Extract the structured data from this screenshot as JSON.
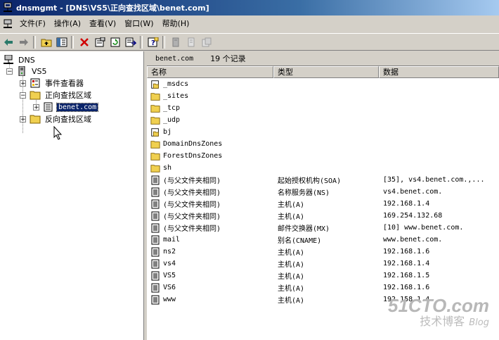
{
  "window": {
    "title": "dnsmgmt - [DNS\\VS5\\正向查找区域\\benet.com]"
  },
  "menu": [
    "文件(F)",
    "操作(A)",
    "查看(V)",
    "窗口(W)",
    "帮助(H)"
  ],
  "toolbar_icons": [
    "back-icon",
    "forward-icon",
    "up-folder-icon",
    "show-tree-icon",
    "delete-icon",
    "properties-icon",
    "refresh-icon",
    "export-icon",
    "help-icon",
    "server-icon",
    "doc-icon",
    "new-record-icon"
  ],
  "tree": {
    "root": "DNS",
    "server": "VS5",
    "event_viewer": "事件查看器",
    "forward_zones": "正向查找区域",
    "zone": "benet.com",
    "reverse_zones": "反向查找区域"
  },
  "list": {
    "zone_name": "benet.com",
    "count": "19 个记录",
    "columns": [
      "名称",
      "类型",
      "数据"
    ],
    "rows": [
      {
        "icon": "folder-doc-icon",
        "name": "_msdcs",
        "type": "",
        "data": ""
      },
      {
        "icon": "folder-icon",
        "name": "_sites",
        "type": "",
        "data": ""
      },
      {
        "icon": "folder-icon",
        "name": "_tcp",
        "type": "",
        "data": ""
      },
      {
        "icon": "folder-icon",
        "name": "_udp",
        "type": "",
        "data": ""
      },
      {
        "icon": "folder-doc-icon",
        "name": "bj",
        "type": "",
        "data": ""
      },
      {
        "icon": "folder-icon",
        "name": "DomainDnsZones",
        "type": "",
        "data": ""
      },
      {
        "icon": "folder-icon",
        "name": "ForestDnsZones",
        "type": "",
        "data": ""
      },
      {
        "icon": "folder-icon",
        "name": "sh",
        "type": "",
        "data": ""
      },
      {
        "icon": "record-icon",
        "name": "(与父文件夹相同)",
        "type": "起始授权机构(SOA)",
        "data": "[35], vs4.benet.com.,..."
      },
      {
        "icon": "record-icon",
        "name": "(与父文件夹相同)",
        "type": "名称服务器(NS)",
        "data": "vs4.benet.com."
      },
      {
        "icon": "record-icon",
        "name": "(与父文件夹相同)",
        "type": "主机(A)",
        "data": "192.168.1.4"
      },
      {
        "icon": "record-icon",
        "name": "(与父文件夹相同)",
        "type": "主机(A)",
        "data": "169.254.132.68"
      },
      {
        "icon": "record-icon",
        "name": "(与父文件夹相同)",
        "type": "邮件交换器(MX)",
        "data": "[10]  www.benet.com."
      },
      {
        "icon": "record-icon",
        "name": "mail",
        "type": "别名(CNAME)",
        "data": "www.benet.com."
      },
      {
        "icon": "record-icon",
        "name": "ns2",
        "type": "主机(A)",
        "data": "192.168.1.6"
      },
      {
        "icon": "record-icon",
        "name": "vs4",
        "type": "主机(A)",
        "data": "192.168.1.4"
      },
      {
        "icon": "record-icon",
        "name": "VS5",
        "type": "主机(A)",
        "data": "192.168.1.5"
      },
      {
        "icon": "record-icon",
        "name": "VS6",
        "type": "主机(A)",
        "data": "192.168.1.6"
      },
      {
        "icon": "record-icon",
        "name": "www",
        "type": "主机(A)",
        "data": "192.158.1.4"
      }
    ]
  },
  "watermark": {
    "line1": "51CTO.com",
    "line2": "技术博客",
    "line3": "Blog"
  }
}
